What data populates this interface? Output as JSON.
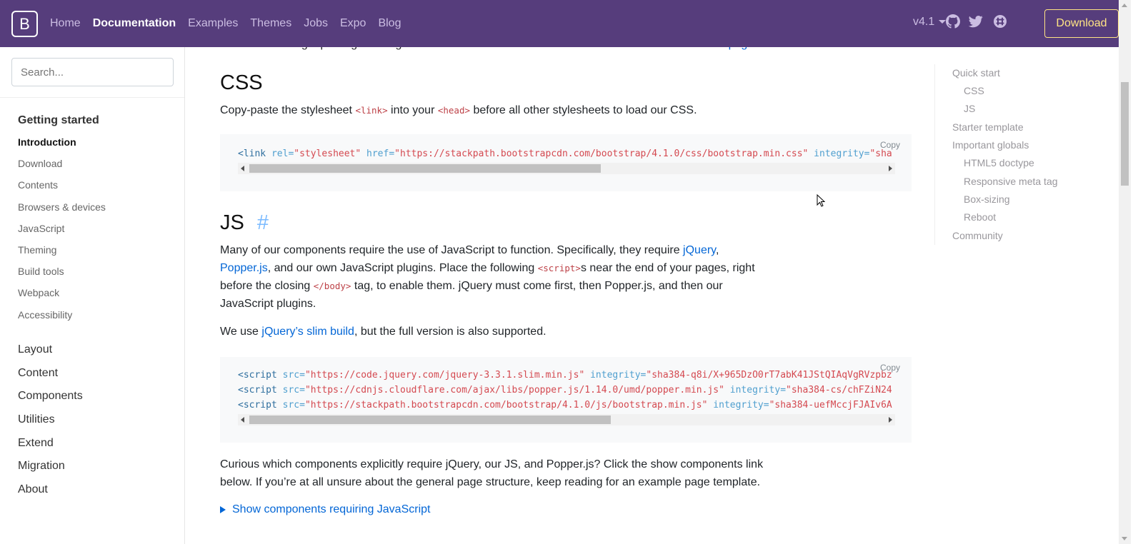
{
  "navbar": {
    "brand": "B",
    "links": [
      {
        "label": "Home",
        "active": false
      },
      {
        "label": "Documentation",
        "active": true
      },
      {
        "label": "Examples",
        "active": false
      },
      {
        "label": "Themes",
        "active": false
      },
      {
        "label": "Jobs",
        "active": false
      },
      {
        "label": "Expo",
        "active": false
      },
      {
        "label": "Blog",
        "active": false
      }
    ],
    "version": "v4.1",
    "download_label": "Download",
    "icons": [
      "github-icon",
      "twitter-icon",
      "slack-icon"
    ]
  },
  "sidebar": {
    "search_placeholder": "Search...",
    "group_title": "Getting started",
    "items": [
      {
        "label": "Introduction",
        "active": true
      },
      {
        "label": "Download",
        "active": false
      },
      {
        "label": "Contents",
        "active": false
      },
      {
        "label": "Browsers & devices",
        "active": false
      },
      {
        "label": "JavaScript",
        "active": false
      },
      {
        "label": "Theming",
        "active": false
      },
      {
        "label": "Build tools",
        "active": false
      },
      {
        "label": "Webpack",
        "active": false
      },
      {
        "label": "Accessibility",
        "active": false
      }
    ],
    "sections": [
      "Layout",
      "Content",
      "Components",
      "Utilities",
      "Extend",
      "Migration",
      "About"
    ]
  },
  "main": {
    "top_text": "StackPath. Using a package manager or need to download the source files? ",
    "top_link": "Head to the downloads page.",
    "css_heading": "CSS",
    "css_text_1": "Copy-paste the stylesheet ",
    "css_code_1": "<link>",
    "css_text_2": " into your ",
    "css_code_2": "<head>",
    "css_text_3": " before all other stylesheets to load our CSS.",
    "copy_label": "Copy",
    "css_snippet": {
      "tag": "<link",
      "attr1": " rel=",
      "val1": "\"stylesheet\"",
      "attr2": " href=",
      "val2": "\"https://stackpath.bootstrapcdn.com/bootstrap/4.1.0/css/bootstrap.min.css\"",
      "attr3": " integrity=",
      "val3": "\"sha"
    },
    "js_heading": "JS",
    "js_anchor": "#",
    "js_p1_a": "Many of our components require the use of JavaScript to function. Specifically, they require ",
    "js_p1_link1": "jQuery",
    "js_p1_b": ",",
    "js_p1_link2": "Popper.js",
    "js_p1_c": ", and our own JavaScript plugins. Place the following ",
    "js_p1_code1": "<script>",
    "js_p1_d": "s near the end of your pages, right",
    "js_p1_e": "before the closing ",
    "js_p1_code2": "</body>",
    "js_p1_f": " tag, to enable them. jQuery must come first, then Popper.js, and then our",
    "js_p1_g": "JavaScript plugins.",
    "js_p2_a": "We use ",
    "js_p2_link": "jQuery’s slim build",
    "js_p2_b": ", but the full version is also supported.",
    "js_snippets": [
      {
        "tag": "<script",
        "attr1": " src=",
        "val1": "\"https://code.jquery.com/jquery-3.3.1.slim.min.js\"",
        "attr2": " integrity=",
        "val2": "\"sha384-q8i/X+965DzO0rT7abK41JStQIAqVgRVzpbz"
      },
      {
        "tag": "<script",
        "attr1": " src=",
        "val1": "\"https://cdnjs.cloudflare.com/ajax/libs/popper.js/1.14.0/umd/popper.min.js\"",
        "attr2": " integrity=",
        "val2": "\"sha384-cs/chFZiN24"
      },
      {
        "tag": "<script",
        "attr1": " src=",
        "val1": "\"https://stackpath.bootstrapcdn.com/bootstrap/4.1.0/js/bootstrap.min.js\"",
        "attr2": " integrity=",
        "val2": "\"sha384-uefMccjFJAIv6A"
      }
    ],
    "curious_1": "Curious which components explicitly require jQuery, our JS, and Popper.js? Click the show components link",
    "curious_2": "below. If you’re at all unsure about the general page structure, keep reading for an example page template.",
    "show_components": "Show components requiring JavaScript"
  },
  "toc": [
    {
      "label": "Quick start",
      "level": 1
    },
    {
      "label": "CSS",
      "level": 2
    },
    {
      "label": "JS",
      "level": 2
    },
    {
      "label": "Starter template",
      "level": 1
    },
    {
      "label": "Important globals",
      "level": 1
    },
    {
      "label": "HTML5 doctype",
      "level": 2
    },
    {
      "label": "Responsive meta tag",
      "level": 2
    },
    {
      "label": "Box-sizing",
      "level": 2
    },
    {
      "label": "Reboot",
      "level": 2
    },
    {
      "label": "Community",
      "level": 1
    }
  ],
  "colors": {
    "navbar_bg": "#563d7c",
    "download_accent": "#ffe484",
    "link": "#0366d6",
    "inline_code": "#bd4147"
  }
}
